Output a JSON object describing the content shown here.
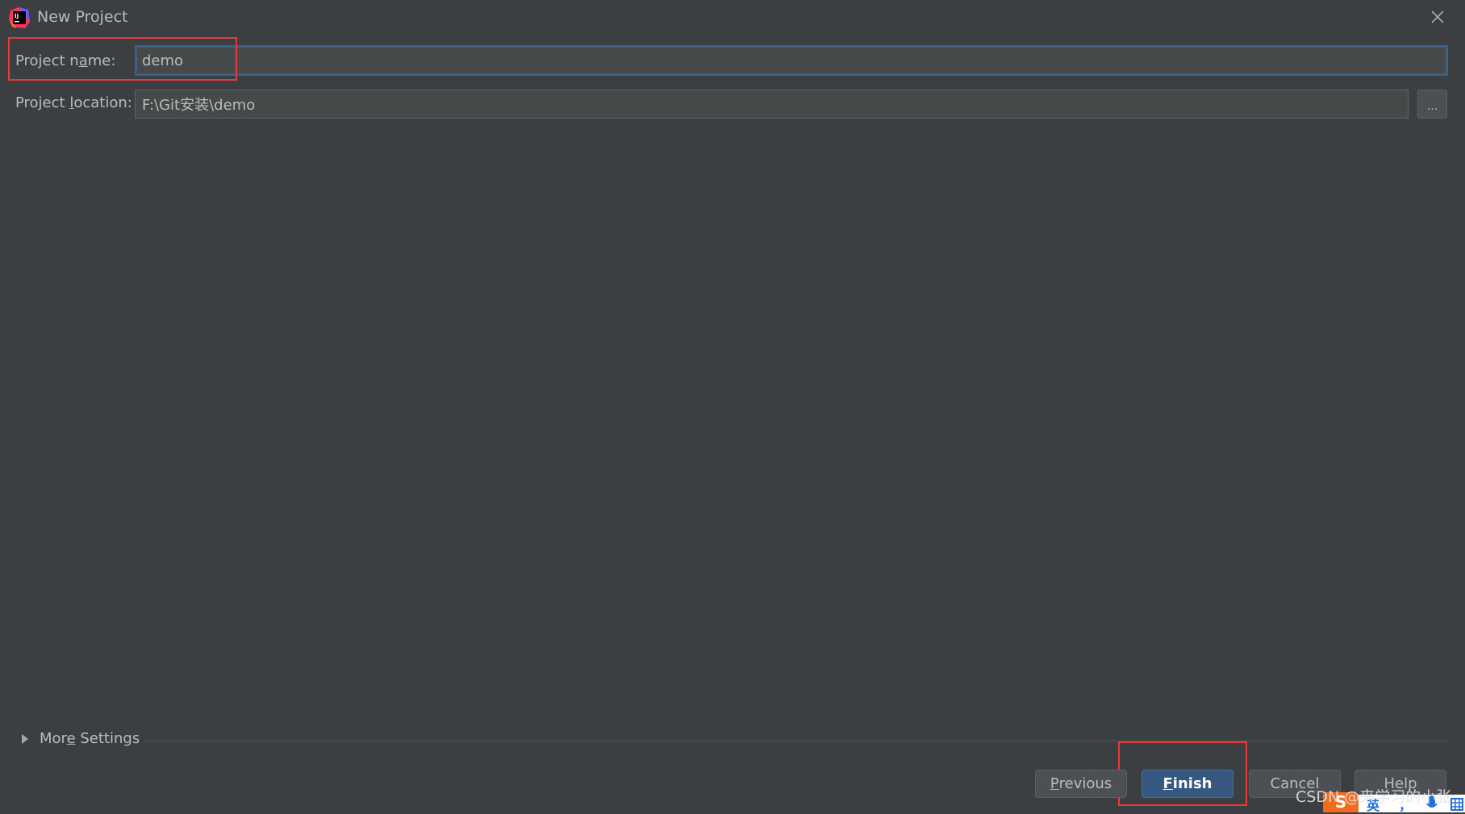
{
  "window": {
    "title": "New Project",
    "app_icon": "intellij-idea-icon",
    "close_icon": "close-icon"
  },
  "form": {
    "project_name": {
      "label_prefix": "Project n",
      "label_mnemonic": "a",
      "label_suffix": "me:",
      "value": "demo"
    },
    "project_location": {
      "label_prefix": "Project ",
      "label_mnemonic": "l",
      "label_suffix": "ocation:",
      "value": "F:\\Git安装\\demo",
      "browse_label": "..."
    }
  },
  "more_settings": {
    "label_prefix": "Mor",
    "label_mnemonic": "e",
    "label_suffix": " Settings",
    "expanded": false
  },
  "buttons": {
    "previous": {
      "mnemonic": "P",
      "rest": "revious"
    },
    "finish": {
      "mnemonic": "F",
      "rest": "inish"
    },
    "cancel": {
      "label": "Cancel"
    },
    "help": {
      "label": "Help"
    }
  },
  "overlay": {
    "watermark": "CSDN @来学习的小张",
    "ime_logo": "S",
    "ime_lang": "英",
    "ime_punct": "，",
    "ime_mic": "mic-icon",
    "ime_grid": "keyboard-grid-icon"
  },
  "colors": {
    "background": "#3c3f41",
    "field_bg": "#45494a",
    "focus_border": "#3d6185",
    "primary_button": "#365880",
    "annotation_red": "#e8393c"
  }
}
